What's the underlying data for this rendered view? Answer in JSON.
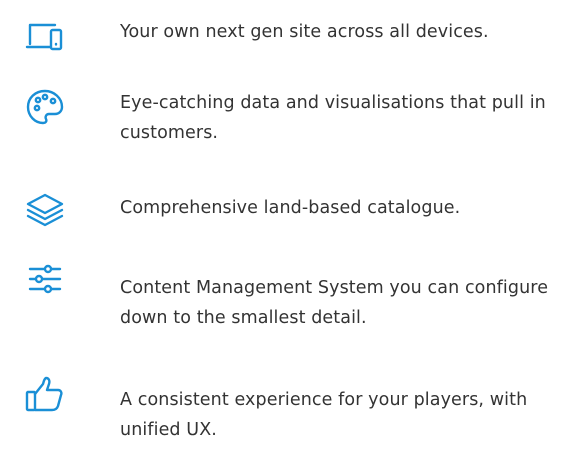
{
  "accent_color": "#1a8fd6",
  "text_color": "#333333",
  "features": [
    {
      "icon": "devices-icon",
      "text": "Your own next gen site across all devices."
    },
    {
      "icon": "palette-icon",
      "text": "Eye-catching data and visualisations that pull in customers."
    },
    {
      "icon": "layers-icon",
      "text": "Comprehensive land-based catalogue."
    },
    {
      "icon": "sliders-icon",
      "text": "Content Management System you can configure down to the smallest detail."
    },
    {
      "icon": "thumbs-up-icon",
      "text": "A consistent experience for your players, with unified UX."
    }
  ]
}
